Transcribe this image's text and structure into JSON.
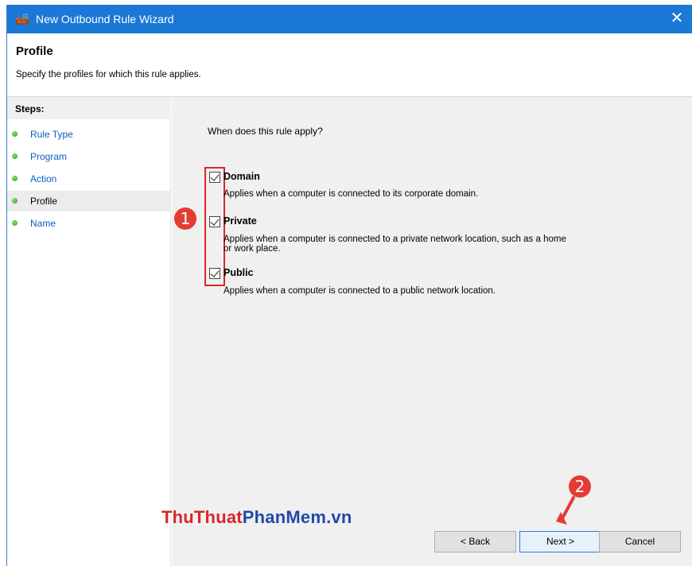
{
  "window": {
    "title": "New Outbound Rule Wizard",
    "close_glyph": "✕"
  },
  "header": {
    "title": "Profile",
    "subtitle": "Specify the profiles for which this rule applies."
  },
  "steps": {
    "title": "Steps:",
    "items": [
      {
        "label": "Rule Type"
      },
      {
        "label": "Program"
      },
      {
        "label": "Action"
      },
      {
        "label": "Profile",
        "current": true
      },
      {
        "label": "Name"
      }
    ]
  },
  "content": {
    "question": "When does this rule apply?",
    "options": [
      {
        "label": "Domain",
        "checked": true,
        "description": "Applies when a computer is connected to its corporate domain."
      },
      {
        "label": "Private",
        "checked": true,
        "description_line1": "Applies when a computer is connected to a private network location, such as a home",
        "description_line2": "or work place."
      },
      {
        "label": "Public",
        "checked": true,
        "description": "Applies when a computer is connected to a public network location."
      }
    ]
  },
  "annotations": {
    "badge1": "1",
    "badge2": "2",
    "accent_color": "#e53b35"
  },
  "watermark": {
    "part1": "ThuThuat",
    "part2": "PhanMem.vn"
  },
  "buttons": {
    "back": "< Back",
    "next": "Next >",
    "cancel": "Cancel"
  },
  "colors": {
    "titlebar": "#1a78d6",
    "step_link": "#0b5dc2",
    "content_bg": "#f0f0f0"
  }
}
